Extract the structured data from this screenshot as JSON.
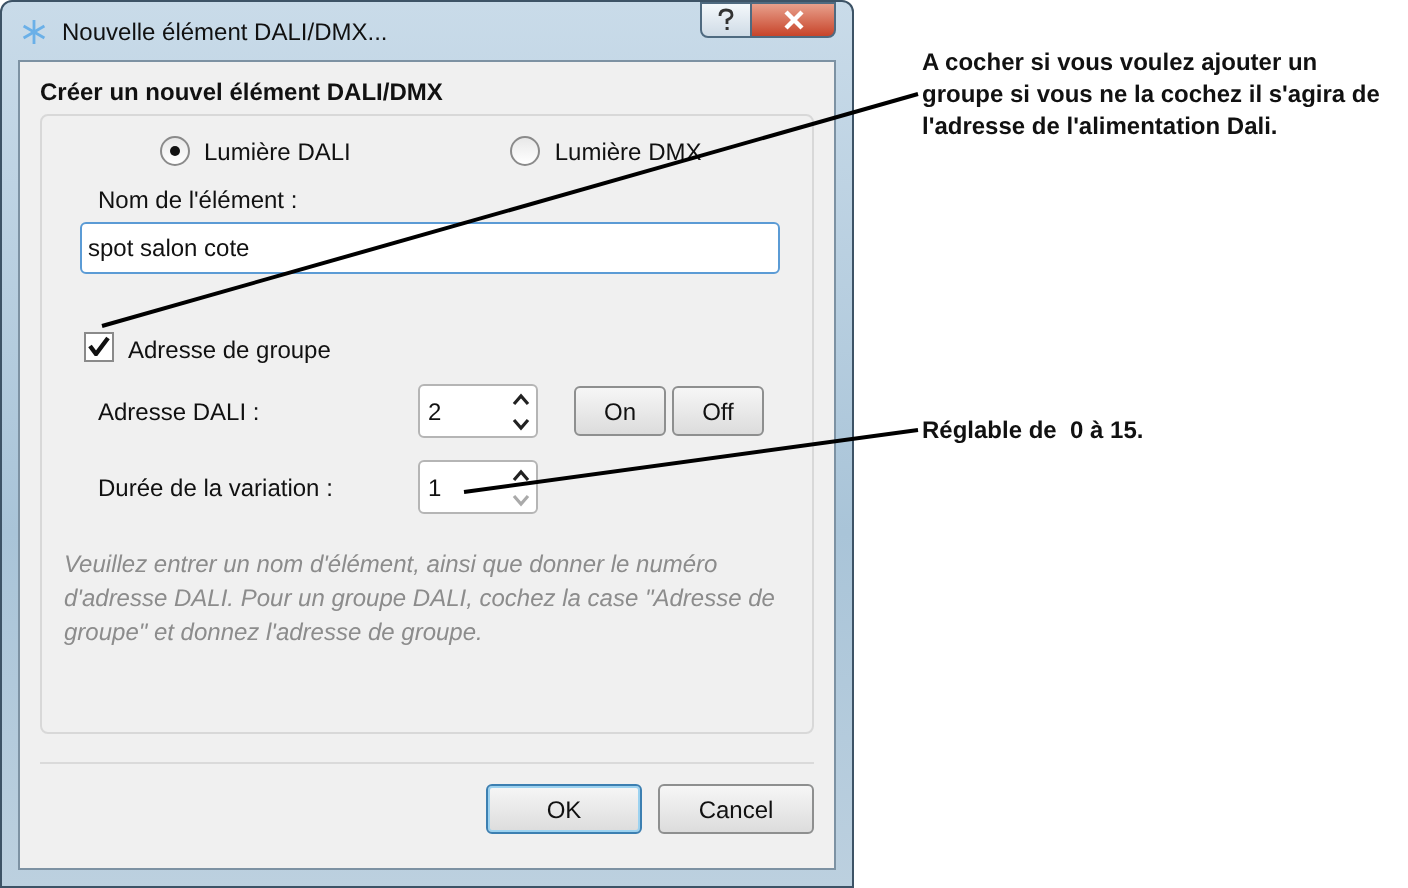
{
  "window": {
    "title": "Nouvelle élément DALI/DMX..."
  },
  "heading": "Créer un nouvel élément DALI/DMX",
  "light_type": [
    {
      "label": "Lumière DALI",
      "selected": true
    },
    {
      "label": "Lumière DMX",
      "selected": false
    }
  ],
  "name_field": {
    "label": "Nom de l'élément :",
    "value": "spot salon cote"
  },
  "group_checkbox": {
    "label": "Adresse de groupe",
    "checked": true
  },
  "spin_rows": [
    {
      "label": "Adresse DALI :",
      "value": "2",
      "buttons": [
        "On",
        "Off"
      ]
    },
    {
      "label": "Durée de la variation :",
      "value": "1"
    }
  ],
  "help_text": "Veuillez entrer un nom d'élément, ainsi que donner le numéro d'adresse DALI. Pour un groupe DALI, cochez la case \"Adresse de groupe\" et donnez l'adresse de groupe.",
  "buttons": [
    {
      "label": "OK",
      "default": true
    },
    {
      "label": "Cancel",
      "default": false
    }
  ],
  "annotations": [
    {
      "text": "A cocher si vous voulez ajouter un groupe si vous ne la cochez il s'agira de l'adresse de l'alimentation Dali."
    },
    {
      "text": "Réglable de  0 à 15."
    }
  ]
}
